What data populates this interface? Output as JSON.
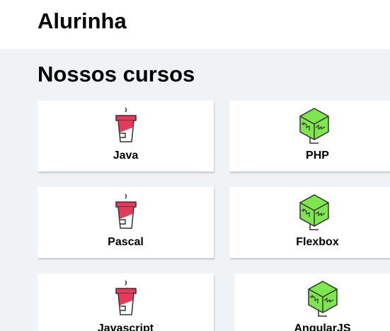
{
  "header": {
    "brand": "Alurinha"
  },
  "main": {
    "title": "Nossos cursos",
    "courses": [
      {
        "name": "Java",
        "icon": "coffee-cup-icon"
      },
      {
        "name": "PHP",
        "icon": "green-cube-icon"
      },
      {
        "name": "Pascal",
        "icon": "coffee-cup-icon"
      },
      {
        "name": "Flexbox",
        "icon": "green-cube-icon"
      },
      {
        "name": "Javascript",
        "icon": "coffee-cup-icon"
      },
      {
        "name": "AngularJS",
        "icon": "green-cube-icon"
      }
    ]
  },
  "colors": {
    "cup_red": "#e63a5a",
    "cube_green": "#7ee64f",
    "outline": "#333333",
    "page_bg": "#f0f3f5"
  }
}
